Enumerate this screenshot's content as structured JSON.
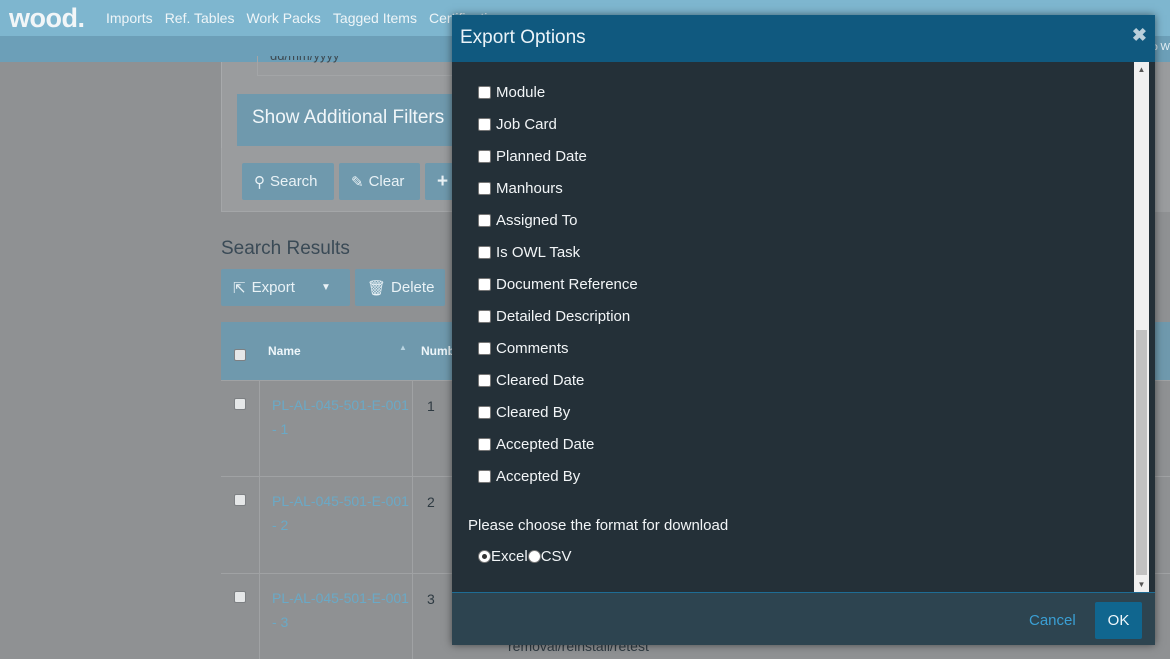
{
  "nav": {
    "logo": "wood.",
    "items": [
      "Imports",
      "Ref. Tables",
      "Work Packs",
      "Tagged Items",
      "Certification"
    ],
    "subbar_right": "ro W"
  },
  "background": {
    "date_placeholder": "dd/mm/yyyy",
    "filters_label": "Show Additional Filters",
    "search_label": "Search",
    "clear_label": "Clear",
    "add_label": "+",
    "results_title": "Search Results",
    "export_label": "Export",
    "delete_label": "Delete",
    "columns": {
      "name": "Name",
      "number": "Numb"
    },
    "rows": [
      {
        "name": "PL-AL-045-501-E-001 - 1",
        "number": "1"
      },
      {
        "name": "PL-AL-045-501-E-001 - 2",
        "number": "2"
      },
      {
        "name": "PL-AL-045-501-E-001 - 3",
        "number": "3"
      }
    ],
    "bottom_text": "removal/reinstall/retest"
  },
  "modal": {
    "title": "Export Options",
    "options": [
      {
        "label": "Module",
        "checked": false
      },
      {
        "label": "Job Card",
        "checked": false
      },
      {
        "label": "Planned Date",
        "checked": false
      },
      {
        "label": "Manhours",
        "checked": false
      },
      {
        "label": "Assigned To",
        "checked": false
      },
      {
        "label": "Is OWL Task",
        "checked": false
      },
      {
        "label": "Document Reference",
        "checked": false
      },
      {
        "label": "Detailed Description",
        "checked": false
      },
      {
        "label": "Comments",
        "checked": false
      },
      {
        "label": "Cleared Date",
        "checked": false
      },
      {
        "label": "Cleared By",
        "checked": false
      },
      {
        "label": "Accepted Date",
        "checked": false
      },
      {
        "label": "Accepted By",
        "checked": false
      }
    ],
    "format_label": "Please choose the format for download",
    "formats": [
      {
        "label": "Excel",
        "selected": true
      },
      {
        "label": "CSV",
        "selected": false
      }
    ],
    "cancel_label": "Cancel",
    "ok_label": "OK"
  }
}
